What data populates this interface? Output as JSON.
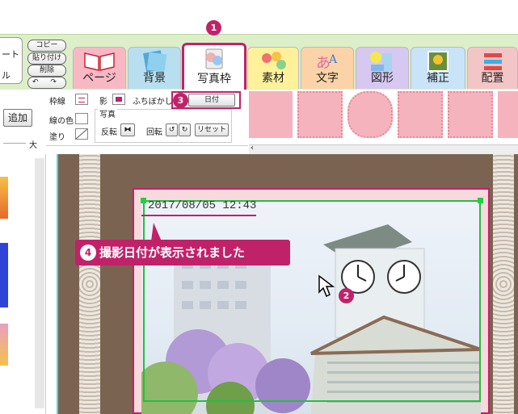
{
  "toolbar": {
    "left_card_top": "ート",
    "left_card_bottom": "ル",
    "copy": "コピー",
    "paste": "貼り付け",
    "delete": "削除",
    "undo_redo": "↶ ↷"
  },
  "tabs": [
    {
      "label": "ページ",
      "color": "#f7b8c4"
    },
    {
      "label": "背景",
      "color": "#b7dff0"
    },
    {
      "label": "写真枠",
      "color": "#ffffff"
    },
    {
      "label": "素材",
      "color": "#fff19a"
    },
    {
      "label": "文字",
      "color": "#fcd3a8"
    },
    {
      "label": "図形",
      "color": "#d6c8f0"
    },
    {
      "label": "補正",
      "color": "#c9e3f9"
    },
    {
      "label": "配置",
      "color": "#f2c6c6"
    }
  ],
  "panel": {
    "border_label": "枠線",
    "shadow_label": "影",
    "blur_label": "ふちぼかし",
    "date_checkbox": "☑",
    "date_label": "日付",
    "line_color_label": "線の色",
    "fill_label": "塗り",
    "photo_label": "写真",
    "flip_label": "反転",
    "rotate_label": "回転",
    "reset_label": "リセット"
  },
  "left_tools": {
    "add_label": "追加",
    "size_label": "大"
  },
  "badges": {
    "one": "1",
    "two": "2",
    "three": "3"
  },
  "photo": {
    "date_stamp": "2017/08/05 12:43"
  },
  "callout": {
    "num": "4",
    "text": "撮影日付が表示されました"
  },
  "colors": {
    "accent": "#c0226a",
    "selection": "#22c040"
  }
}
